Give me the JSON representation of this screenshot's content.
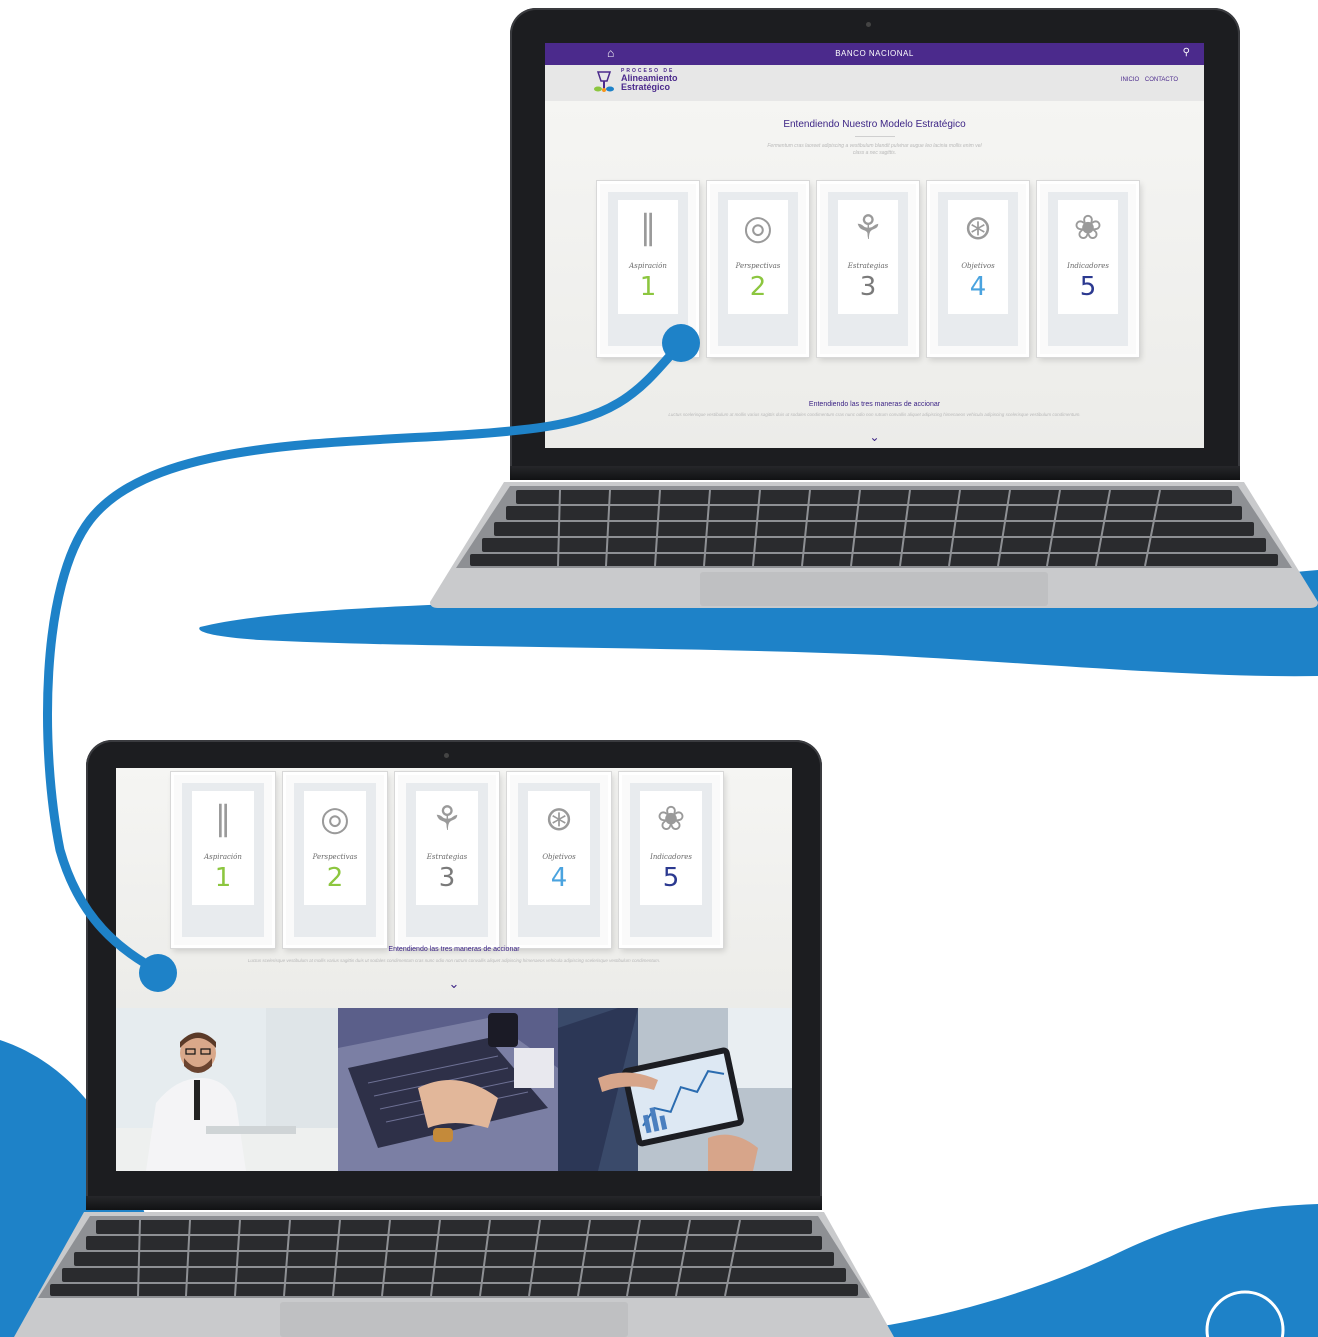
{
  "colors": {
    "accent_blue": "#1e82c8",
    "site_purple": "#4b2a8c",
    "num1": "#8cc63f",
    "num2": "#8cc63f",
    "num3": "#7a7a7a",
    "num4": "#4aa3df",
    "num5": "#2b3990"
  },
  "site": {
    "topbar": {
      "home_icon": "home-icon",
      "brand": "BANCO NACIONAL",
      "search_icon": "search-icon"
    },
    "logo": {
      "line1": "PROCESO DE",
      "line2": "Alineamiento Estratégico"
    },
    "nav": {
      "inicio": "INICIO",
      "contacto": "CONTACTO"
    },
    "section1": {
      "title": "Entendiendo Nuestro Modelo Estratégico",
      "intro": "Fermentum cras laoreet adipiscing a vestibulum blandit pulvinar augue leo lacinia mollis enim vel class a nec sagittis."
    },
    "frames": [
      {
        "caption": "Aspiración",
        "number": "1"
      },
      {
        "caption": "Perspectivas",
        "number": "2"
      },
      {
        "caption": "Estrategias",
        "number": "3"
      },
      {
        "caption": "Objetivos",
        "number": "4"
      },
      {
        "caption": "Indicadores",
        "number": "5"
      }
    ],
    "section2": {
      "title": "Entendiendo las tres maneras de accionar",
      "text": "Luctus scelerisque vestibulum at mollis varius sagittis duis ut sodales condimentum cras nunc odio non rutrum convallis aliquet adipiscing himenaeos vehicula adipiscing scelerisque vestibulum condimentum.",
      "chevron_icon": "chevron-down-icon"
    },
    "photos": [
      "office-worker-photo",
      "laptop-typing-photo",
      "tablet-chart-photo"
    ]
  }
}
